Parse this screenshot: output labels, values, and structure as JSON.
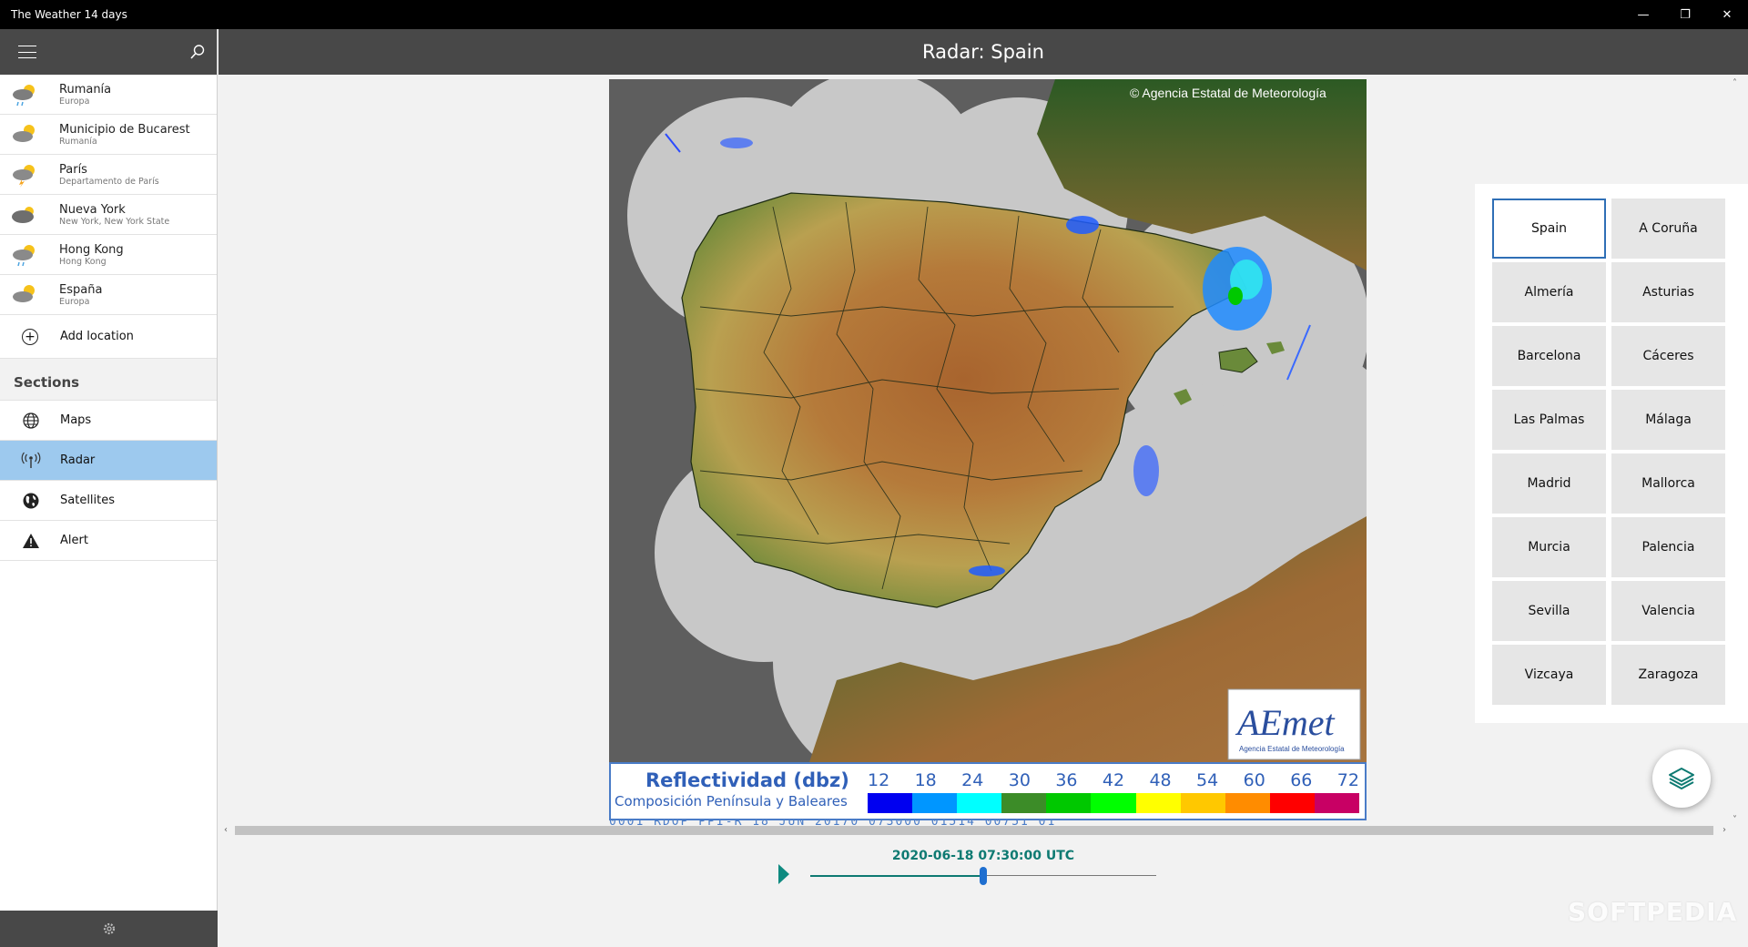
{
  "window": {
    "title": "The Weather 14 days",
    "controls": {
      "minimize": "—",
      "restore": "❐",
      "close": "✕"
    }
  },
  "sidebar": {
    "locations": [
      {
        "name": "Rumanía",
        "sub": "Europa",
        "icon": "rain-cloud-icon"
      },
      {
        "name": "Municipio de Bucarest",
        "sub": "Rumanía",
        "icon": "partly-cloudy-icon"
      },
      {
        "name": "París",
        "sub": "Departamento de París",
        "icon": "storm-icon"
      },
      {
        "name": "Nueva York",
        "sub": "New York, New York State",
        "icon": "cloud-icon"
      },
      {
        "name": "Hong Kong",
        "sub": "Hong Kong",
        "icon": "rain-sun-icon"
      },
      {
        "name": "España",
        "sub": "Europa",
        "icon": "partly-cloudy-icon"
      }
    ],
    "add_location": "Add location",
    "sections_title": "Sections",
    "sections": [
      {
        "label": "Maps",
        "icon": "globe-icon"
      },
      {
        "label": "Radar",
        "icon": "radar-icon",
        "active": true
      },
      {
        "label": "Satellites",
        "icon": "earth-icon"
      },
      {
        "label": "Alert",
        "icon": "warning-icon"
      }
    ]
  },
  "header": {
    "title": "Radar: Spain"
  },
  "map": {
    "copyright": "© Agencia Estatal de Meteorología",
    "logo_text": "AEmet",
    "logo_sub": "Agencia Estatal de Meteorología",
    "strip_text": "0001 RDOP PPI-R   18 JUN 20170 073000 01514 00751 01",
    "legend": {
      "title": "Reflectividad (dbz)",
      "subtitle": "Composición Península y Baleares",
      "values": [
        "12",
        "18",
        "24",
        "30",
        "36",
        "42",
        "48",
        "54",
        "60",
        "66",
        "72"
      ],
      "colors": [
        "#0000f0",
        "#0096ff",
        "#00ffff",
        "#3c8c28",
        "#00c800",
        "#00ff00",
        "#ffff00",
        "#ffc800",
        "#ff8c00",
        "#ff0000",
        "#c80064"
      ]
    }
  },
  "timeline": {
    "timestamp": "2020-06-18 07:30:00 UTC",
    "position": 0.5
  },
  "regions": [
    "Spain",
    "A Coruña",
    "Almería",
    "Asturias",
    "Barcelona",
    "Cáceres",
    "Las Palmas",
    "Málaga",
    "Madrid",
    "Mallorca",
    "Murcia",
    "Palencia",
    "Sevilla",
    "Valencia",
    "Vizcaya",
    "Zaragoza"
  ],
  "selected_region": "Spain",
  "watermark": "SOFTPEDIA"
}
